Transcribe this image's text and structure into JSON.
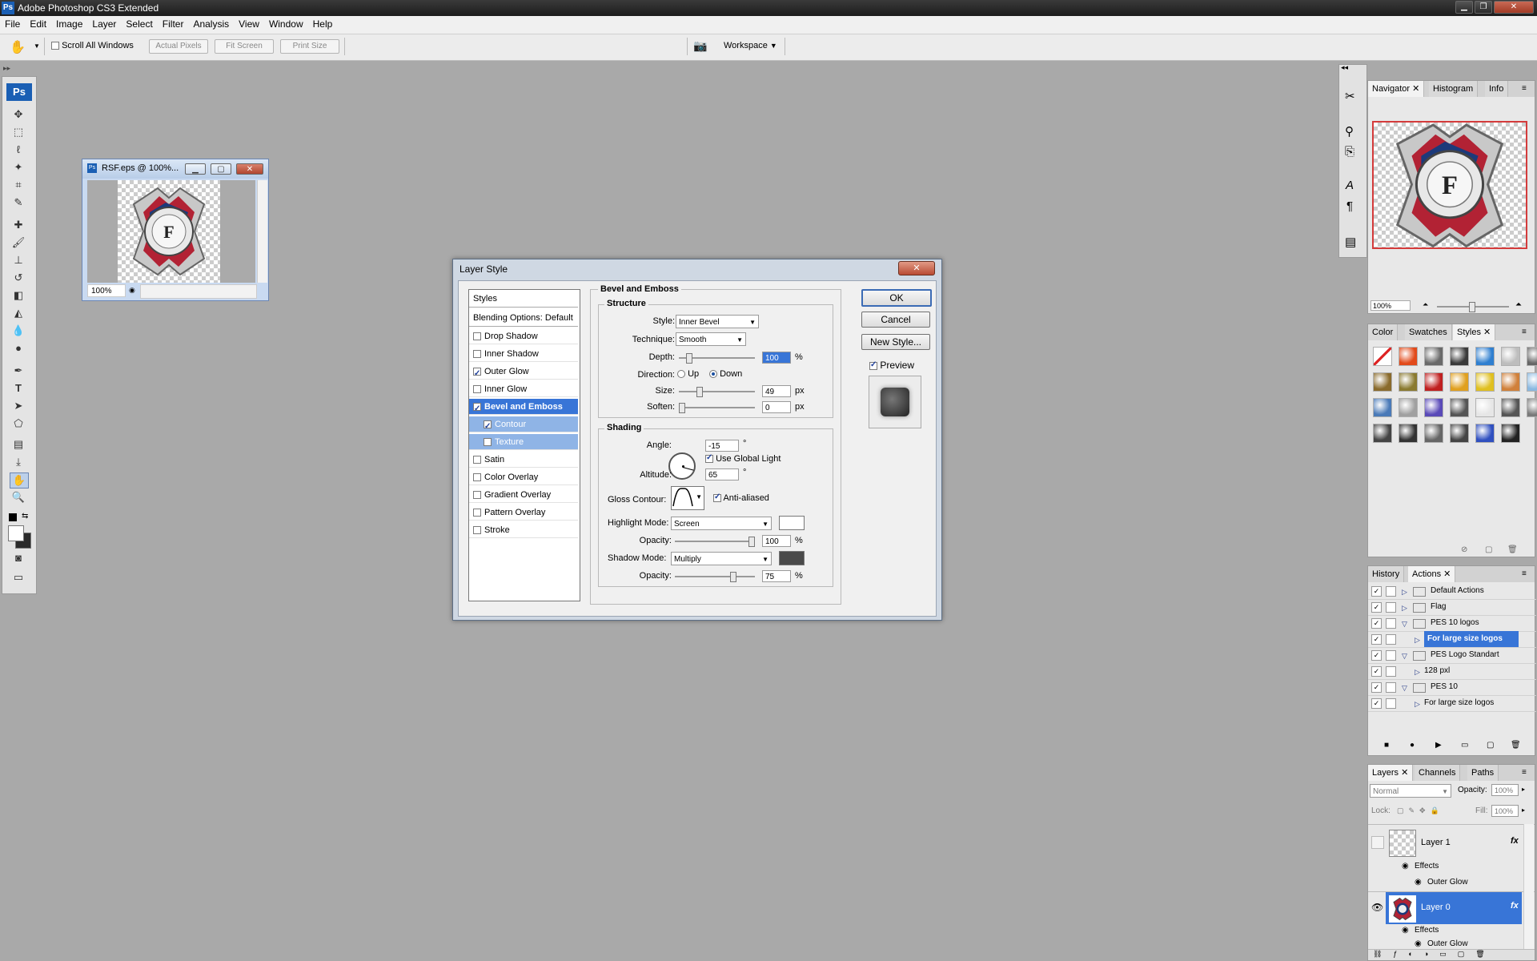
{
  "app": {
    "title": "Adobe Photoshop CS3 Extended",
    "logo": "Ps"
  },
  "menu": [
    "File",
    "Edit",
    "Image",
    "Layer",
    "Select",
    "Filter",
    "Analysis",
    "View",
    "Window",
    "Help"
  ],
  "options_bar": {
    "scroll_all": "Scroll All Windows",
    "actual_pixels": "Actual Pixels",
    "fit_screen": "Fit Screen",
    "print_size": "Print Size",
    "workspace": "Workspace"
  },
  "document": {
    "title": "RSF.eps @ 100%...",
    "zoom": "100%"
  },
  "dialog": {
    "title": "Layer Style",
    "styles_header": "Styles",
    "blending": "Blending Options: Default",
    "effects": [
      {
        "label": "Drop Shadow",
        "checked": false
      },
      {
        "label": "Inner Shadow",
        "checked": false
      },
      {
        "label": "Outer Glow",
        "checked": true
      },
      {
        "label": "Inner Glow",
        "checked": false
      },
      {
        "label": "Bevel and Emboss",
        "checked": true
      },
      {
        "label": "Contour",
        "checked": true
      },
      {
        "label": "Texture",
        "checked": false
      },
      {
        "label": "Satin",
        "checked": false
      },
      {
        "label": "Color Overlay",
        "checked": false
      },
      {
        "label": "Gradient Overlay",
        "checked": false
      },
      {
        "label": "Pattern Overlay",
        "checked": false
      },
      {
        "label": "Stroke",
        "checked": false
      }
    ],
    "section_title": "Bevel and Emboss",
    "structure": {
      "title": "Structure",
      "style_label": "Style:",
      "style_value": "Inner Bevel",
      "technique_label": "Technique:",
      "technique_value": "Smooth",
      "depth_label": "Depth:",
      "depth_value": "100",
      "depth_unit": "%",
      "depth_pos": 0.1,
      "direction_label": "Direction:",
      "up": "Up",
      "down": "Down",
      "size_label": "Size:",
      "size_value": "49",
      "size_unit": "px",
      "size_pos": 0.25,
      "soften_label": "Soften:",
      "soften_value": "0",
      "soften_unit": "px",
      "soften_pos": 0
    },
    "shading": {
      "title": "Shading",
      "angle_label": "Angle:",
      "angle_value": "-15",
      "deg": "°",
      "global_light": "Use Global Light",
      "altitude_label": "Altitude:",
      "altitude_value": "65",
      "gloss_label": "Gloss Contour:",
      "anti_aliased": "Anti-aliased",
      "highlight_label": "Highlight Mode:",
      "highlight_value": "Screen",
      "highlight_color": "#ffffff",
      "opacity_label": "Opacity:",
      "hl_opacity": "100",
      "hl_opacity_pos": 1.0,
      "pct": "%",
      "shadow_label": "Shadow Mode:",
      "shadow_value": "Multiply",
      "shadow_color": "#4a4a4a",
      "sh_opacity": "75",
      "sh_opacity_pos": 0.75
    },
    "ok": "OK",
    "cancel": "Cancel",
    "new_style": "New Style...",
    "preview": "Preview"
  },
  "navigator": {
    "tabs": [
      "Navigator",
      "Histogram",
      "Info"
    ],
    "zoom": "100%"
  },
  "swatch_panel": {
    "tabs": [
      "Color",
      "Swatches",
      "Styles"
    ]
  },
  "actions_panel": {
    "tabs": [
      "History",
      "Actions"
    ],
    "rows": [
      {
        "label": "Default Actions",
        "indent": 0,
        "folder": true,
        "expanded": false,
        "selected": false
      },
      {
        "label": "Flag",
        "indent": 0,
        "folder": true,
        "expanded": false,
        "selected": false
      },
      {
        "label": "PES 10 logos",
        "indent": 0,
        "folder": true,
        "expanded": true,
        "selected": false
      },
      {
        "label": "For large size logos",
        "indent": 1,
        "folder": false,
        "expanded": false,
        "selected": true
      },
      {
        "label": "PES Logo Standart",
        "indent": 0,
        "folder": true,
        "expanded": true,
        "selected": false
      },
      {
        "label": "128 pxl",
        "indent": 1,
        "folder": false,
        "expanded": false,
        "selected": false
      },
      {
        "label": "PES 10",
        "indent": 0,
        "folder": true,
        "expanded": true,
        "selected": false
      },
      {
        "label": "For large size logos",
        "indent": 1,
        "folder": false,
        "expanded": false,
        "selected": false
      }
    ]
  },
  "layers_panel": {
    "tabs": [
      "Layers",
      "Channels",
      "Paths"
    ],
    "blend": "Normal",
    "opacity_label": "Opacity:",
    "opacity": "100%",
    "lock_label": "Lock:",
    "fill_label": "Fill:",
    "fill": "100%",
    "layer1": "Layer 1",
    "layer0": "Layer 0",
    "effects": "Effects",
    "outer_glow": "Outer Glow",
    "fx": "fx"
  }
}
